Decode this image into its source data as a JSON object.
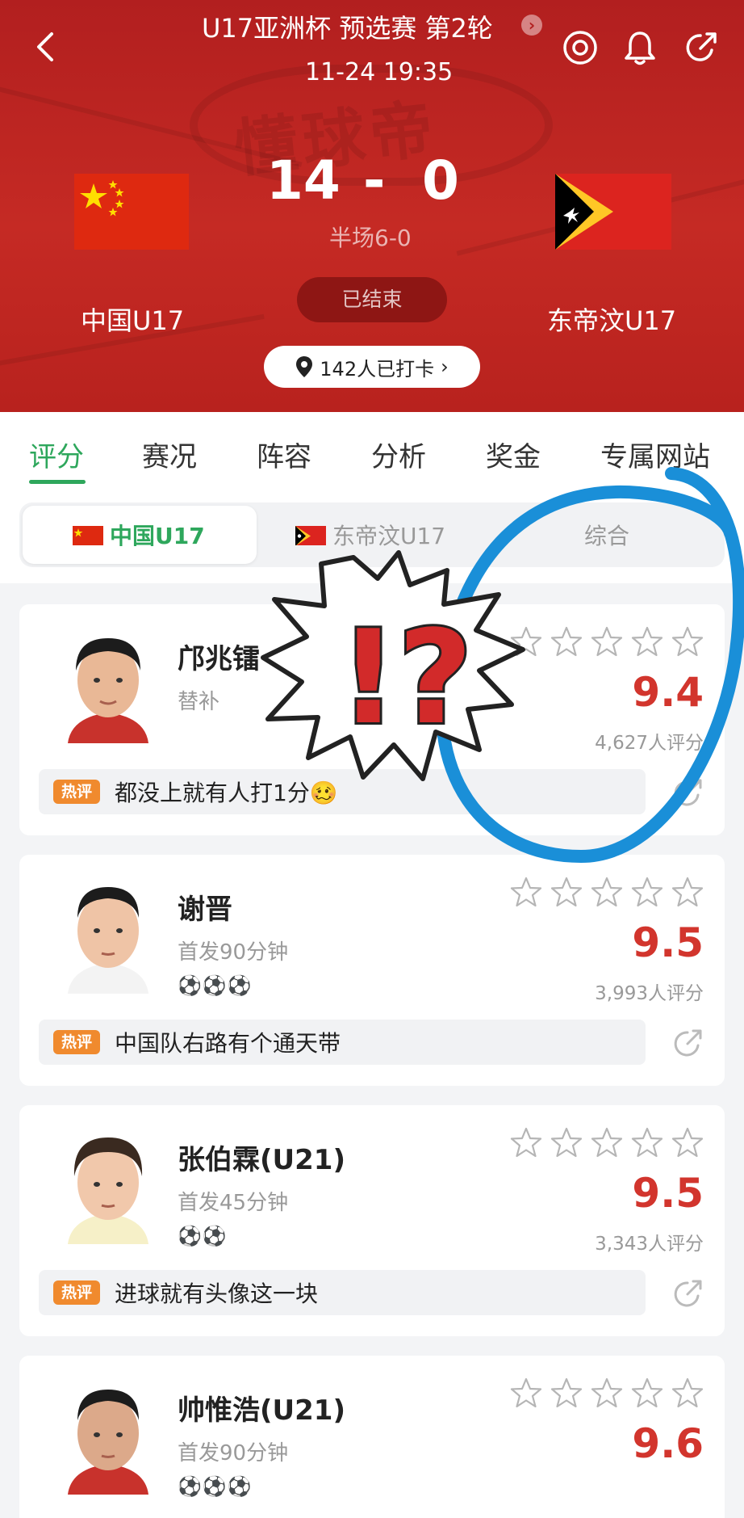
{
  "header": {
    "title": "U17亚洲杯 预选赛 第2轮",
    "title_arrow": "›",
    "datetime": "11-24 19:35",
    "watermark": "懂球帝",
    "home_team": "中国U17",
    "away_team": "东帝汶U17",
    "home_score": "14",
    "score_separator": "-",
    "away_score": "0",
    "halftime": "半场6-0",
    "status": "已结束",
    "checkin": "142人已打卡",
    "checkin_arrow": "›"
  },
  "tabs": [
    {
      "label": "评分",
      "active": true
    },
    {
      "label": "赛况"
    },
    {
      "label": "阵容"
    },
    {
      "label": "分析"
    },
    {
      "label": "奖金"
    },
    {
      "label": "专属网站"
    }
  ],
  "segment": {
    "home": "中国U17",
    "away": "东帝汶U17",
    "all": "综合"
  },
  "players": [
    {
      "name": "邝兆镭",
      "role": "替补",
      "goals": "",
      "rating": "9.4",
      "raters": "4,627人评分",
      "hot_tag": "热评",
      "comment": "都没上就有人打1分🥴"
    },
    {
      "name": "谢晋",
      "role": "首发90分钟",
      "goals": "⚽⚽⚽",
      "rating": "9.5",
      "raters": "3,993人评分",
      "hot_tag": "热评",
      "comment": "中国队右路有个通天带"
    },
    {
      "name": "张伯霖(U21)",
      "role": "首发45分钟",
      "goals": "⚽⚽",
      "rating": "9.5",
      "raters": "3,343人评分",
      "hot_tag": "热评",
      "comment": "进球就有头像这一块"
    },
    {
      "name": "帅惟浩(U21)",
      "role": "首发90分钟",
      "goals": "⚽⚽⚽",
      "rating": "9.6",
      "raters": "",
      "hot_tag": "",
      "comment": ""
    }
  ],
  "overlay": {
    "exclamation": "!?",
    "circle_color": "#1a8fd8",
    "accent_green": "#2ea75c",
    "rating_red": "#d2352d",
    "header_red": "#b21f1f"
  }
}
